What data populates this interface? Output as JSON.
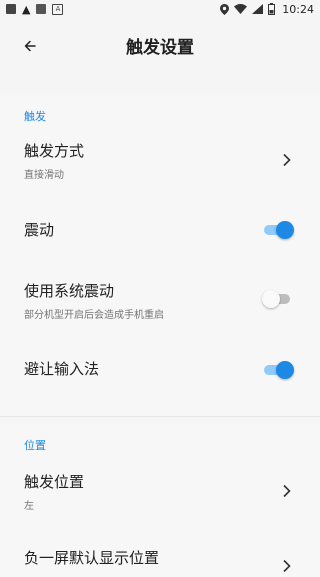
{
  "status_bar": {
    "time": "10:24"
  },
  "app_bar": {
    "title": "触发设置"
  },
  "sections": {
    "trigger": {
      "header": "触发",
      "trigger_mode": {
        "title": "触发方式",
        "value": "直接滑动"
      },
      "vibration": {
        "title": "震动",
        "enabled": true
      },
      "system_vibration": {
        "title": "使用系统震动",
        "subtitle": "部分机型开启后会造成手机重启",
        "enabled": false
      },
      "avoid_ime": {
        "title": "避让输入法",
        "enabled": true
      }
    },
    "position": {
      "header": "位置",
      "trigger_position": {
        "title": "触发位置",
        "value": "左"
      },
      "minus_one_screen": {
        "title": "负一屏默认显示位置"
      }
    }
  },
  "colors": {
    "accent": "#1e88e5",
    "track_on": "#90caf9"
  }
}
